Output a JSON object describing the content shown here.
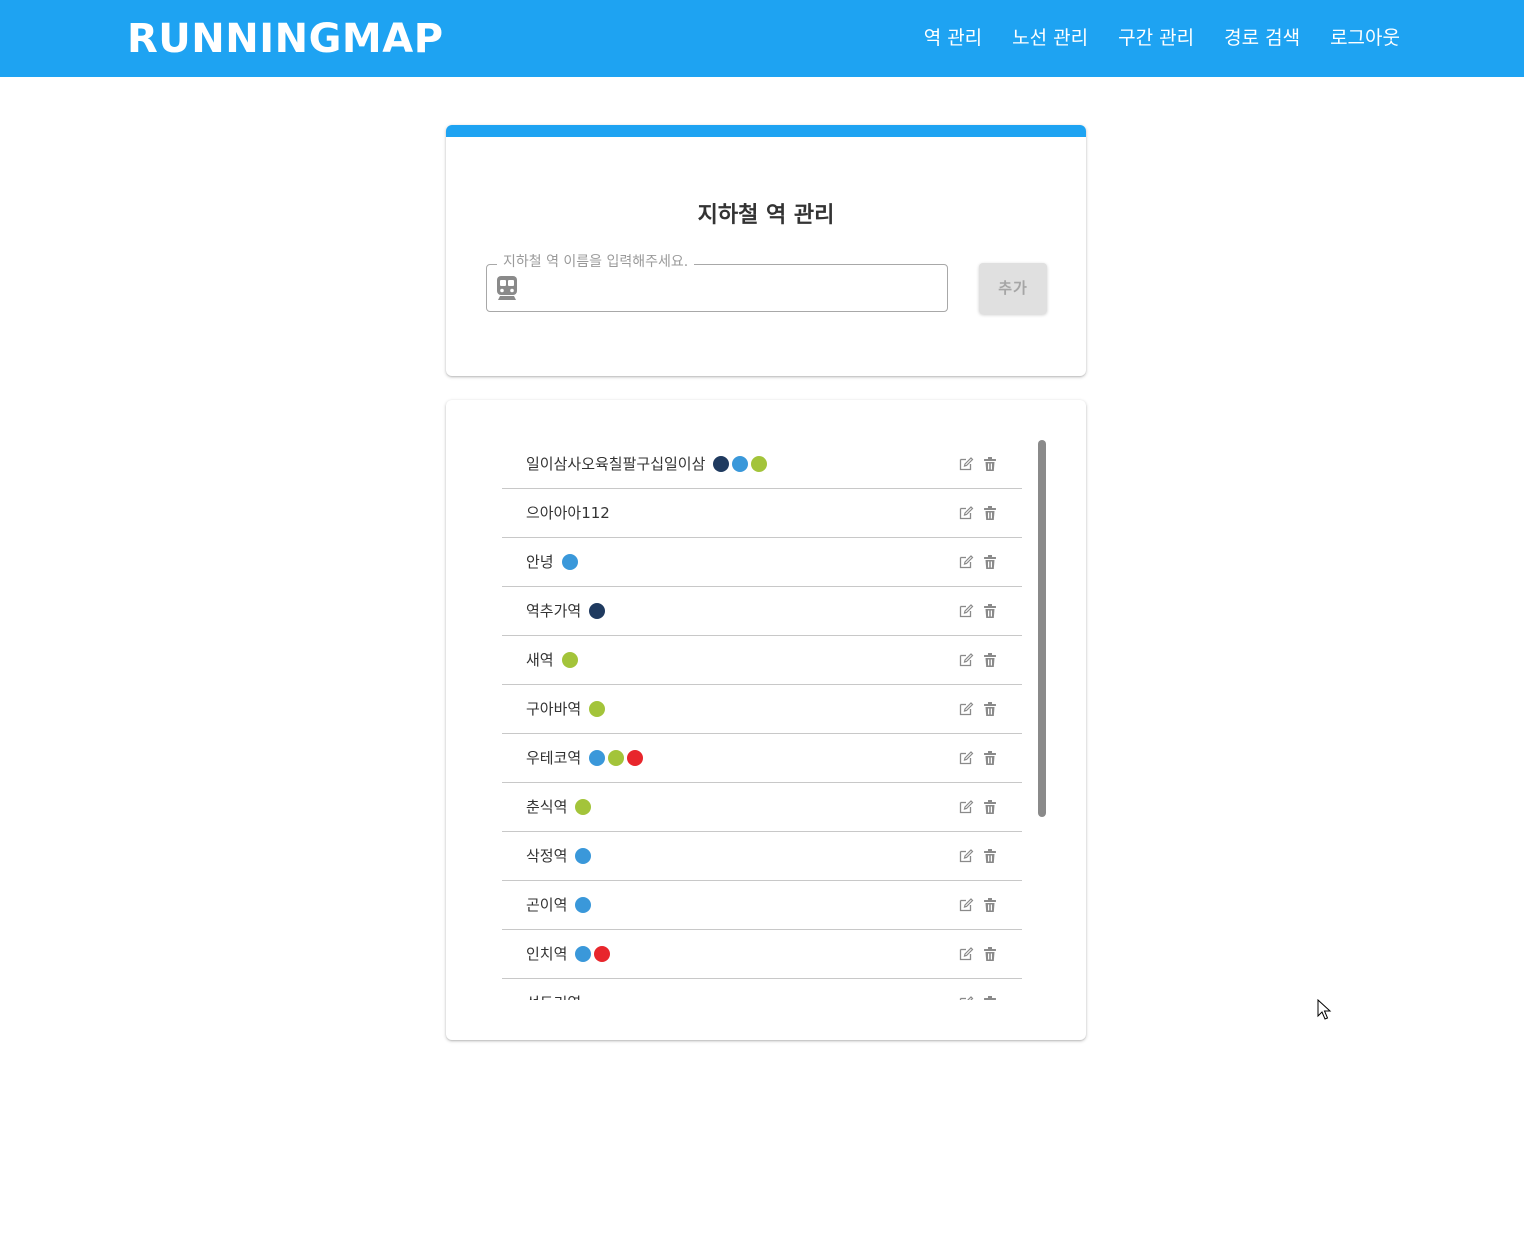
{
  "header": {
    "brand": "RUNNINGMAP",
    "nav": [
      "역 관리",
      "노선 관리",
      "구간 관리",
      "경로 검색",
      "로그아웃"
    ],
    "color": "#1ea3f2"
  },
  "form": {
    "title": "지하철 역 관리",
    "input_label": "지하철 역 이름을 입력해주세요.",
    "input_value": "",
    "input_icon": "subway-icon",
    "add_button": "추가"
  },
  "colors": {
    "navy": "#1f3a5f",
    "blue": "#3a98da",
    "green": "#a3c43a",
    "red": "#e8262c"
  },
  "stations": [
    {
      "name": "일이삼사오육칠팔구십일이삼",
      "lines": [
        "navy",
        "blue",
        "green"
      ]
    },
    {
      "name": "으아아아112",
      "lines": []
    },
    {
      "name": "안녕",
      "lines": [
        "blue"
      ]
    },
    {
      "name": "역추가역",
      "lines": [
        "navy"
      ]
    },
    {
      "name": "새역",
      "lines": [
        "green"
      ]
    },
    {
      "name": "구아바역",
      "lines": [
        "green"
      ]
    },
    {
      "name": "우테코역",
      "lines": [
        "blue",
        "green",
        "red"
      ]
    },
    {
      "name": "춘식역",
      "lines": [
        "green"
      ]
    },
    {
      "name": "삭정역",
      "lines": [
        "blue"
      ]
    },
    {
      "name": "곤이역",
      "lines": [
        "blue"
      ]
    },
    {
      "name": "인치역",
      "lines": [
        "blue",
        "red"
      ]
    },
    {
      "name": "선두리역",
      "lines": []
    }
  ],
  "row_icons": {
    "edit": "edit-icon",
    "delete": "trash-icon"
  }
}
